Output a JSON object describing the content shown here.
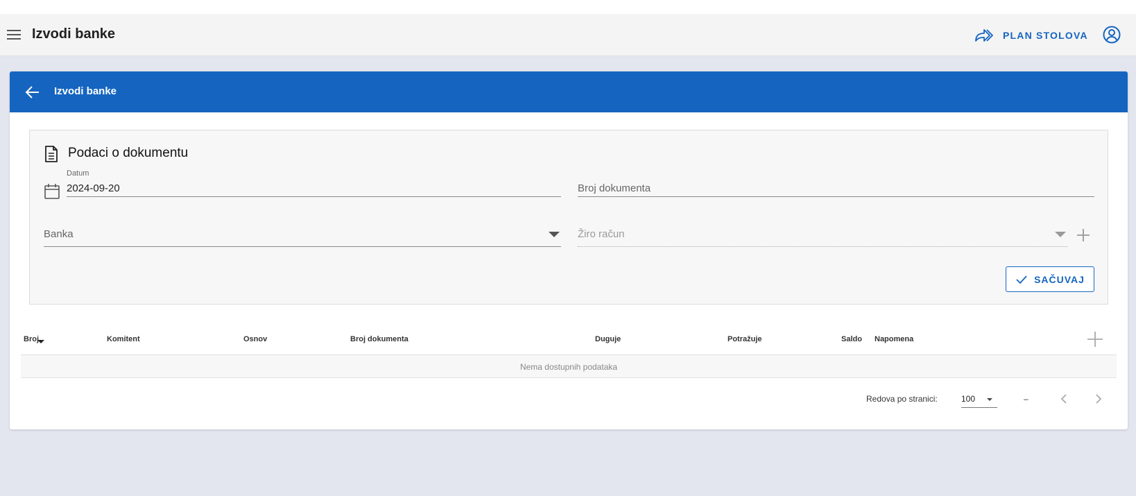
{
  "appbar": {
    "title": "Izvodi banke",
    "plan_button": "PLAN STOLOVA"
  },
  "card": {
    "header_title": "Izvodi banke"
  },
  "panel": {
    "title": "Podaci o dokumentu",
    "datum_label": "Datum",
    "datum_value": "2024-09-20",
    "broj_dokumenta_placeholder": "Broj dokumenta",
    "banka_placeholder": "Banka",
    "ziro_racun_placeholder": "Žiro račun",
    "save_label": "SAČUVAJ"
  },
  "table": {
    "columns": [
      "Broj",
      "Komitent",
      "Osnov",
      "Broj dokumenta",
      "Duguje",
      "Potražuje",
      "Saldo",
      "Napomena"
    ],
    "empty_text": "Nema dostupnih podataka"
  },
  "pagination": {
    "rows_per_page_label": "Redova po stranici:",
    "rows_per_page_value": "100",
    "range_text": "–"
  },
  "colors": {
    "primary": "#1565c0",
    "appbar_bg": "#f4f4f4",
    "page_bg": "#e3e6ef"
  },
  "icons": [
    "menu-icon",
    "share-forward-icon",
    "user-circle-icon",
    "arrow-left-icon",
    "document-icon",
    "calendar-icon",
    "chevron-down-icon",
    "plus-icon",
    "check-icon",
    "sort-desc-icon",
    "chevron-left-icon",
    "chevron-right-icon"
  ]
}
